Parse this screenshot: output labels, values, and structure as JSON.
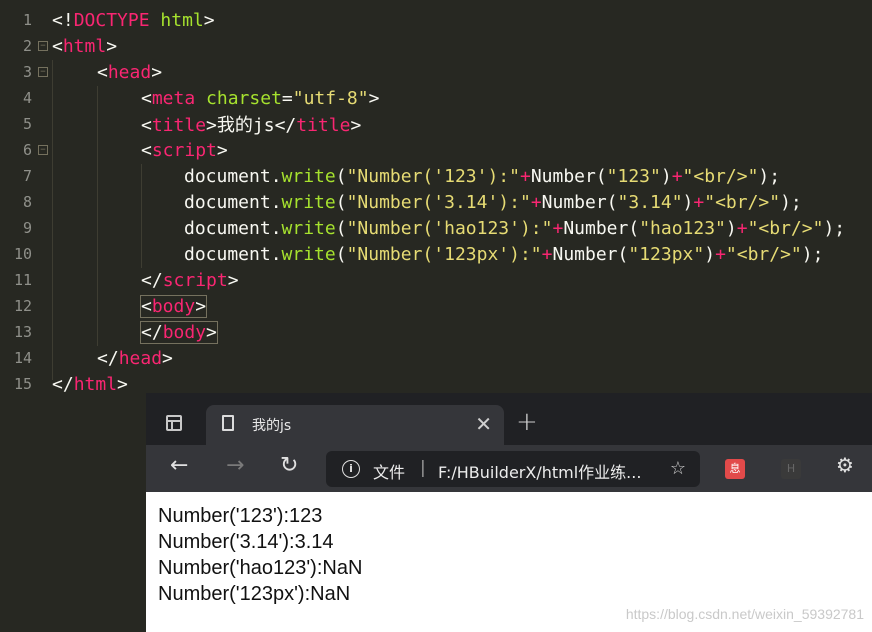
{
  "editor": {
    "line_numbers": [
      "1",
      "2",
      "3",
      "4",
      "5",
      "6",
      "7",
      "8",
      "9",
      "10",
      "11",
      "12",
      "13",
      "14",
      "15"
    ],
    "lines": [
      {
        "parts": [
          {
            "t": "<!",
            "c": "plain"
          },
          {
            "t": "DOCTYPE",
            "c": "doctype"
          },
          {
            "t": " ",
            "c": "plain"
          },
          {
            "t": "html",
            "c": "attr"
          },
          {
            "t": ">",
            "c": "plain"
          }
        ]
      },
      {
        "parts": [
          {
            "t": "<",
            "c": "plain"
          },
          {
            "t": "html",
            "c": "tag"
          },
          {
            "t": ">",
            "c": "plain"
          }
        ]
      },
      {
        "parts": [
          {
            "t": "<",
            "c": "plain"
          },
          {
            "t": "head",
            "c": "tag"
          },
          {
            "t": ">",
            "c": "plain"
          }
        ]
      },
      {
        "parts": [
          {
            "t": "<",
            "c": "plain"
          },
          {
            "t": "meta",
            "c": "tag"
          },
          {
            "t": " ",
            "c": "plain"
          },
          {
            "t": "charset",
            "c": "attr"
          },
          {
            "t": "=",
            "c": "plain"
          },
          {
            "t": "\"utf-8\"",
            "c": "str"
          },
          {
            "t": ">",
            "c": "plain"
          }
        ]
      },
      {
        "parts": [
          {
            "t": "<",
            "c": "plain"
          },
          {
            "t": "title",
            "c": "tag"
          },
          {
            "t": ">",
            "c": "plain"
          },
          {
            "t": "我的js",
            "c": "plain"
          },
          {
            "t": "</",
            "c": "plain"
          },
          {
            "t": "title",
            "c": "tag"
          },
          {
            "t": ">",
            "c": "plain"
          }
        ]
      },
      {
        "parts": [
          {
            "t": "<",
            "c": "plain"
          },
          {
            "t": "script",
            "c": "tag"
          },
          {
            "t": ">",
            "c": "plain"
          }
        ]
      },
      {
        "parts": [
          {
            "t": "document.",
            "c": "plain"
          },
          {
            "t": "write",
            "c": "fn"
          },
          {
            "t": "(",
            "c": "plain"
          },
          {
            "t": "\"Number('123'):\"",
            "c": "str"
          },
          {
            "t": "+",
            "c": "tag"
          },
          {
            "t": "Number(",
            "c": "plain"
          },
          {
            "t": "\"123\"",
            "c": "str"
          },
          {
            "t": ")",
            "c": "plain"
          },
          {
            "t": "+",
            "c": "tag"
          },
          {
            "t": "\"<br/>\"",
            "c": "str"
          },
          {
            "t": ");",
            "c": "plain"
          }
        ]
      },
      {
        "parts": [
          {
            "t": "document.",
            "c": "plain"
          },
          {
            "t": "write",
            "c": "fn"
          },
          {
            "t": "(",
            "c": "plain"
          },
          {
            "t": "\"Number('3.14'):\"",
            "c": "str"
          },
          {
            "t": "+",
            "c": "tag"
          },
          {
            "t": "Number(",
            "c": "plain"
          },
          {
            "t": "\"3.14\"",
            "c": "str"
          },
          {
            "t": ")",
            "c": "plain"
          },
          {
            "t": "+",
            "c": "tag"
          },
          {
            "t": "\"<br/>\"",
            "c": "str"
          },
          {
            "t": ");",
            "c": "plain"
          }
        ]
      },
      {
        "parts": [
          {
            "t": "document.",
            "c": "plain"
          },
          {
            "t": "write",
            "c": "fn"
          },
          {
            "t": "(",
            "c": "plain"
          },
          {
            "t": "\"Number('hao123'):\"",
            "c": "str"
          },
          {
            "t": "+",
            "c": "tag"
          },
          {
            "t": "Number(",
            "c": "plain"
          },
          {
            "t": "\"hao123\"",
            "c": "str"
          },
          {
            "t": ")",
            "c": "plain"
          },
          {
            "t": "+",
            "c": "tag"
          },
          {
            "t": "\"<br/>\"",
            "c": "str"
          },
          {
            "t": ");",
            "c": "plain"
          }
        ]
      },
      {
        "parts": [
          {
            "t": "document.",
            "c": "plain"
          },
          {
            "t": "write",
            "c": "fn"
          },
          {
            "t": "(",
            "c": "plain"
          },
          {
            "t": "\"Number('123px'):\"",
            "c": "str"
          },
          {
            "t": "+",
            "c": "tag"
          },
          {
            "t": "Number(",
            "c": "plain"
          },
          {
            "t": "\"123px\"",
            "c": "str"
          },
          {
            "t": ")",
            "c": "plain"
          },
          {
            "t": "+",
            "c": "tag"
          },
          {
            "t": "\"<br/>\"",
            "c": "str"
          },
          {
            "t": ");",
            "c": "plain"
          }
        ]
      },
      {
        "parts": [
          {
            "t": "</",
            "c": "plain"
          },
          {
            "t": "script",
            "c": "tag"
          },
          {
            "t": ">",
            "c": "plain"
          }
        ]
      },
      {
        "parts": [
          {
            "t": "<",
            "c": "plain"
          },
          {
            "t": "body",
            "c": "tag"
          },
          {
            "t": ">",
            "c": "plain"
          }
        ]
      },
      {
        "parts": [
          {
            "t": "</",
            "c": "plain"
          },
          {
            "t": "body",
            "c": "tag"
          },
          {
            "t": ">",
            "c": "plain"
          }
        ]
      },
      {
        "parts": [
          {
            "t": "</",
            "c": "plain"
          },
          {
            "t": "head",
            "c": "tag"
          },
          {
            "t": ">",
            "c": "plain"
          }
        ]
      },
      {
        "parts": [
          {
            "t": "</",
            "c": "plain"
          },
          {
            "t": "html",
            "c": "tag"
          },
          {
            "t": ">",
            "c": "plain"
          }
        ]
      }
    ]
  },
  "browser": {
    "tab_title": "我的js",
    "address_scheme": "文件",
    "address_separator": "|",
    "address_url": "F:/HBuilderX/html作业练...",
    "extension_1_label": "息",
    "extension_2_label": "H",
    "output_lines": [
      "Number('123'):123",
      "Number('3.14'):3.14",
      "Number('hao123'):NaN",
      "Number('123px'):NaN"
    ]
  },
  "watermark": "https://blog.csdn.net/weixin_59392781",
  "colors": {
    "editor_bg": "#272822",
    "tag": "#f92672",
    "attr": "#a6e22e",
    "string": "#e6db74"
  }
}
